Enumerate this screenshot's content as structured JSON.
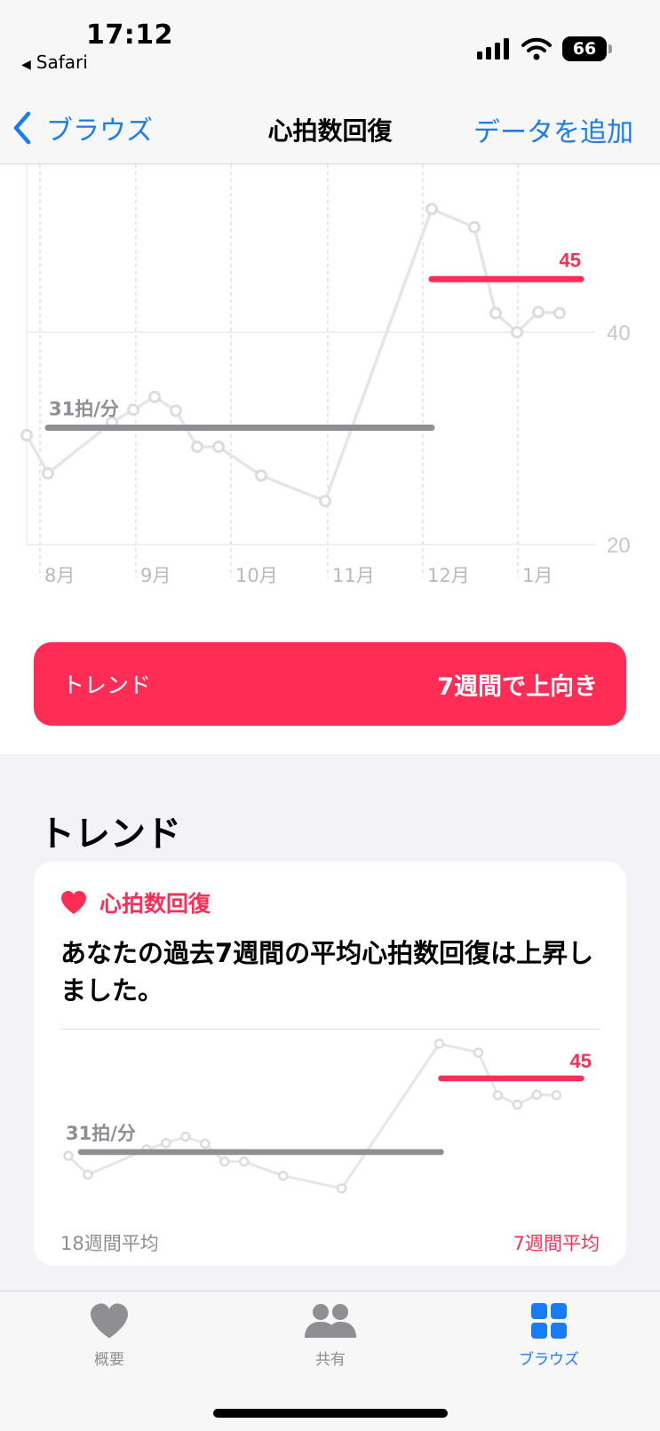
{
  "status_bar": {
    "time": "17:12",
    "back_app": "Safari",
    "battery": "66"
  },
  "nav": {
    "back_label": "ブラウズ",
    "title": "心拍数回復",
    "add_label": "データを追加"
  },
  "colors": {
    "accent": "#ff2d55",
    "link": "#1a7cf5",
    "line": "#e5e5ea",
    "average": "#8e8e93"
  },
  "chart_data": {
    "type": "line",
    "y_axis_ticks": [
      "40",
      "20"
    ],
    "x_axis_labels": [
      "8月",
      "9月",
      "10月",
      "11月",
      "12月",
      "1月"
    ],
    "ylim": [
      20,
      50
    ],
    "x_range": [
      0,
      80
    ],
    "grid": true,
    "series": [
      {
        "x": [
          0,
          3,
          12,
          15,
          18,
          21,
          24,
          27,
          33,
          42,
          57,
          63,
          66,
          69,
          72,
          75
        ],
        "y": [
          30.3,
          26.7,
          31.5,
          32.7,
          33.9,
          32.6,
          29.2,
          29.2,
          26.5,
          24.1,
          51.6,
          49.9,
          41.8,
          40.0,
          41.9,
          41.8
        ]
      }
    ],
    "averages": [
      {
        "label": "31拍/分",
        "value": 31,
        "x_start": 3,
        "x_end": 57
      },
      {
        "label": "45",
        "value": 45,
        "x_start": 57,
        "x_end": 78
      }
    ]
  },
  "trend": {
    "label": "トレンド",
    "value": "7週間で上向き"
  },
  "section": {
    "title": "トレンド"
  },
  "card": {
    "category": "心拍数回復",
    "message": "あなたの過去7週間の平均心拍数回復は上昇しました。",
    "avg_old_label": "31拍/分",
    "avg_new_label": "45",
    "foot_left": "18週間平均",
    "foot_right": "7週間平均"
  },
  "tabs": [
    {
      "label": "概要",
      "icon": "heart-icon"
    },
    {
      "label": "共有",
      "icon": "people-icon"
    },
    {
      "label": "ブラウズ",
      "icon": "grid-icon"
    }
  ]
}
